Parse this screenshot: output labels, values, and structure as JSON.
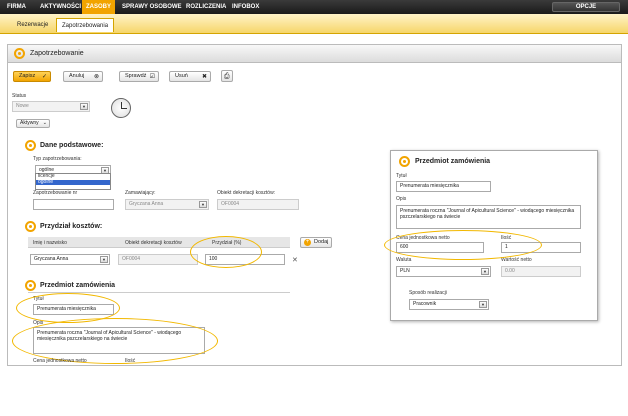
{
  "topnav": {
    "items": [
      "FIRMA",
      "AKTYWNOŚCI",
      "ZASOBY",
      "SPRAWY OSOBOWE",
      "ROZLICZENIA",
      "INFOBOX"
    ],
    "opcje": "OPCJE"
  },
  "subnav": {
    "tabs": [
      "Rezerwacje",
      "Zapotrzebowania"
    ]
  },
  "window": {
    "title": "Zapotrzebowanie"
  },
  "toolbar": {
    "save": "Zapisz",
    "cancel": "Anuluj",
    "check": "Sprawdź",
    "delete": "Usuń"
  },
  "status": {
    "label": "Status",
    "value": "Nowe",
    "active": "Aktywny"
  },
  "dane": {
    "title": "Dane podstawowe:",
    "type_label": "Typ zapotrzebowania:",
    "type_value": "ogólne",
    "type_options": [
      "licencje",
      "ogólne"
    ],
    "number_label": "Zapotrzebowanie nr",
    "orderer_label": "Zamawiający:",
    "orderer_value": "Gryczana Anna",
    "cost_label": "Obiekt dekretacji kosztów:",
    "cost_value": "OF0004"
  },
  "przydzial": {
    "title": "Przydział kosztów:",
    "headers": [
      "Imię i nazwisko",
      "Obiekt dekretacji kosztów",
      "Przydział (%)"
    ],
    "add": "Dodaj",
    "row": {
      "name": "Gryczana Anna",
      "object": "OF0004",
      "percent": "100"
    }
  },
  "przedmiot": {
    "title": "Przedmiot zamówienia",
    "title_label": "Tytuł",
    "title_value": "Prenumerata miesięcznika",
    "desc_label": "Opis",
    "desc_value": "Prenumerata roczna \"Journal of Apicultural Science\" - wiodącego miesięcznika pszczelarskiego na świecie",
    "price_label": "Cena jednostkowa netto",
    "qty_label": "Ilość"
  },
  "panel": {
    "title": "Przedmiot zamówienia",
    "title_label": "Tytuł",
    "title_value": "Prenumerata miesięcznika",
    "desc_label": "Opis",
    "desc_value": "Prenumerata roczna \"Journal of Apicultural Science\" - wiodącego miesięcznika pszczelarskiego na świecie",
    "price_label": "Cena jednostkowa netto",
    "price_value": "600",
    "qty_label": "Ilość",
    "qty_value": "1",
    "currency_label": "Waluta",
    "currency_value": "PLN",
    "net_label": "Wartość netto",
    "net_value": "0.00",
    "method_label": "Sposób realizacji",
    "method_value": "Pracownik"
  },
  "colors": {
    "accent": "#f2a400",
    "nav_bg": "#1a1a1a",
    "highlight": "#f2b800"
  }
}
